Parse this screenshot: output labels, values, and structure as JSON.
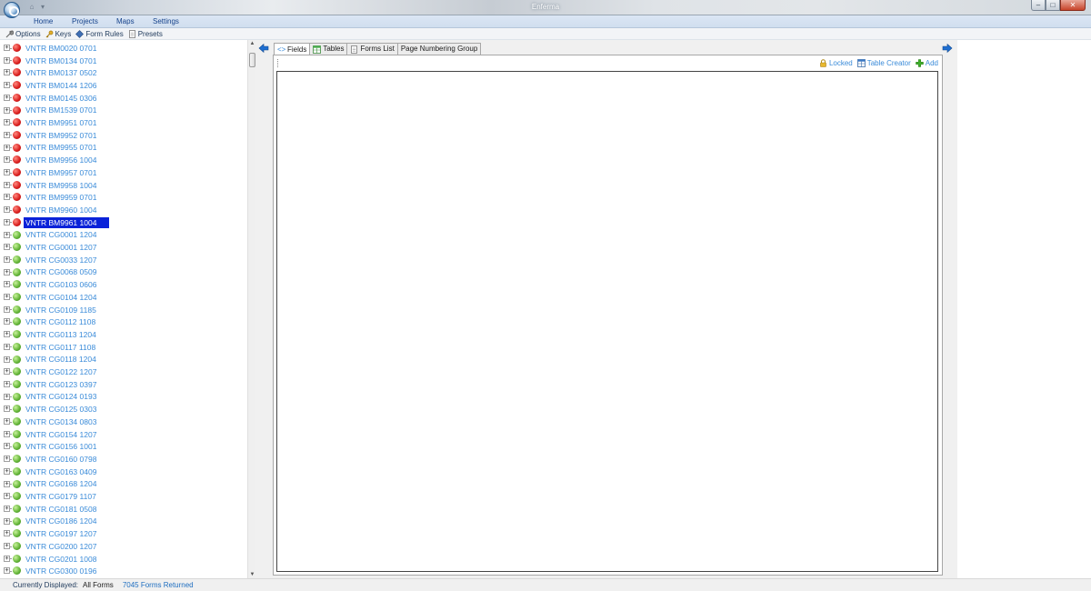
{
  "window": {
    "title": "Enferma",
    "buttons": {
      "minimize": "–",
      "maximize": "□",
      "close": "✕"
    }
  },
  "ribbon": {
    "tabs": [
      {
        "label": "Home"
      },
      {
        "label": "Projects"
      },
      {
        "label": "Maps"
      },
      {
        "label": "Settings"
      }
    ]
  },
  "toolbar": {
    "items": [
      {
        "label": "Options",
        "icon": "wrench-icon"
      },
      {
        "label": "Keys",
        "icon": "key-icon"
      },
      {
        "label": "Form Rules",
        "icon": "diamond-arrow-icon"
      },
      {
        "label": "Presets",
        "icon": "document-icon"
      }
    ]
  },
  "tree": {
    "selected_index": 14,
    "items": [
      {
        "label": "VNTR BM0020 0701",
        "status": "red"
      },
      {
        "label": "VNTR BM0134 0701",
        "status": "red"
      },
      {
        "label": "VNTR BM0137 0502",
        "status": "red"
      },
      {
        "label": "VNTR BM0144 1206",
        "status": "red"
      },
      {
        "label": "VNTR BM0145 0306",
        "status": "red"
      },
      {
        "label": "VNTR BM1539 0701",
        "status": "red"
      },
      {
        "label": "VNTR BM9951 0701",
        "status": "red"
      },
      {
        "label": "VNTR BM9952 0701",
        "status": "red"
      },
      {
        "label": "VNTR BM9955 0701",
        "status": "red"
      },
      {
        "label": "VNTR BM9956 1004",
        "status": "red"
      },
      {
        "label": "VNTR BM9957 0701",
        "status": "red"
      },
      {
        "label": "VNTR BM9958 1004",
        "status": "red"
      },
      {
        "label": "VNTR BM9959 0701",
        "status": "red"
      },
      {
        "label": "VNTR BM9960 1004",
        "status": "red"
      },
      {
        "label": "VNTR BM9961 1004",
        "status": "red"
      },
      {
        "label": "VNTR CG0001 1204",
        "status": "green"
      },
      {
        "label": "VNTR CG0001 1207",
        "status": "green"
      },
      {
        "label": "VNTR CG0033 1207",
        "status": "green"
      },
      {
        "label": "VNTR CG0068 0509",
        "status": "green"
      },
      {
        "label": "VNTR CG0103 0606",
        "status": "green"
      },
      {
        "label": "VNTR CG0104 1204",
        "status": "green"
      },
      {
        "label": "VNTR CG0109 1185",
        "status": "green"
      },
      {
        "label": "VNTR CG0112 1108",
        "status": "green"
      },
      {
        "label": "VNTR CG0113 1204",
        "status": "green"
      },
      {
        "label": "VNTR CG0117 1108",
        "status": "green"
      },
      {
        "label": "VNTR CG0118 1204",
        "status": "green"
      },
      {
        "label": "VNTR CG0122 1207",
        "status": "green"
      },
      {
        "label": "VNTR CG0123 0397",
        "status": "green"
      },
      {
        "label": "VNTR CG0124 0193",
        "status": "green"
      },
      {
        "label": "VNTR CG0125 0303",
        "status": "green"
      },
      {
        "label": "VNTR CG0134 0803",
        "status": "green"
      },
      {
        "label": "VNTR CG0154 1207",
        "status": "green"
      },
      {
        "label": "VNTR CG0156 1001",
        "status": "green"
      },
      {
        "label": "VNTR CG0160 0798",
        "status": "green"
      },
      {
        "label": "VNTR CG0163 0409",
        "status": "green"
      },
      {
        "label": "VNTR CG0168 1204",
        "status": "green"
      },
      {
        "label": "VNTR CG0179 1107",
        "status": "green"
      },
      {
        "label": "VNTR CG0181 0508",
        "status": "green"
      },
      {
        "label": "VNTR CG0186 1204",
        "status": "green"
      },
      {
        "label": "VNTR CG0197 1207",
        "status": "green"
      },
      {
        "label": "VNTR CG0200 1207",
        "status": "green"
      },
      {
        "label": "VNTR CG0201 1008",
        "status": "green"
      },
      {
        "label": "VNTR CG0300 0196",
        "status": "green"
      }
    ]
  },
  "main": {
    "tabs": [
      {
        "label": "Fields",
        "icon": "code-brackets-icon",
        "active": true
      },
      {
        "label": "Tables",
        "icon": "table-icon",
        "active": false
      },
      {
        "label": "Forms List",
        "icon": "document-icon",
        "active": false
      },
      {
        "label": "Page Numbering Group",
        "icon": "",
        "active": false
      }
    ],
    "tools": {
      "locked": "Locked",
      "table_creator": "Table Creator",
      "add": "Add"
    }
  },
  "status_bar": {
    "label": "Currently Displayed:",
    "value": "All Forms",
    "count": "7045 Forms Returned"
  },
  "colors": {
    "link_blue": "#3a8bd9",
    "selection": "#0a22d9",
    "status_red": "#d81b1b",
    "status_green": "#5fb234",
    "nav_arrow": "#1f6fd1"
  }
}
